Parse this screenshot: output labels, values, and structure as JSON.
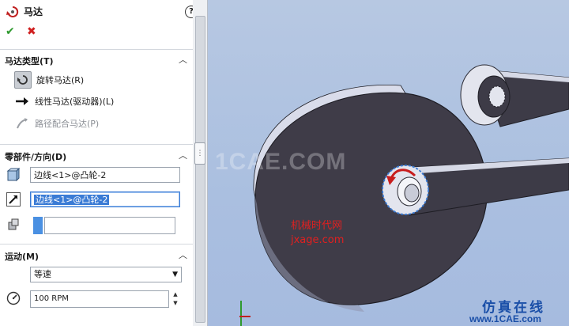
{
  "panel": {
    "title": "马达",
    "help": "?",
    "ok_symbol": "✔",
    "cancel_symbol": "✖",
    "motor_type": {
      "heading": "马达类型(T)",
      "options": [
        {
          "label": "旋转马达(R)",
          "icon": "rotary-motor-icon",
          "selected": true
        },
        {
          "label": "线性马达(驱动器)(L)",
          "icon": "linear-motor-icon",
          "selected": false
        },
        {
          "label": "路径配合马达(P)",
          "icon": "path-mate-motor-icon",
          "selected": false,
          "disabled": true
        }
      ]
    },
    "component": {
      "heading": "零部件/方向(D)",
      "location_value": "边线<1>@凸轮-2",
      "direction_value": "边线<1>@凸轮-2",
      "component_value": ""
    },
    "motion": {
      "heading": "运动(M)",
      "type_value": "等速",
      "speed_value": "100 RPM"
    }
  },
  "viewport": {
    "watermarks": [
      "1CAE.COM",
      "机械时代网",
      "jxage.com",
      "仿真在线",
      "www.1CAE.com"
    ]
  },
  "colors": {
    "viewport_bg": "#aabfe0",
    "accent": "#3a7bd5",
    "cam_body": "#3f3c48"
  }
}
